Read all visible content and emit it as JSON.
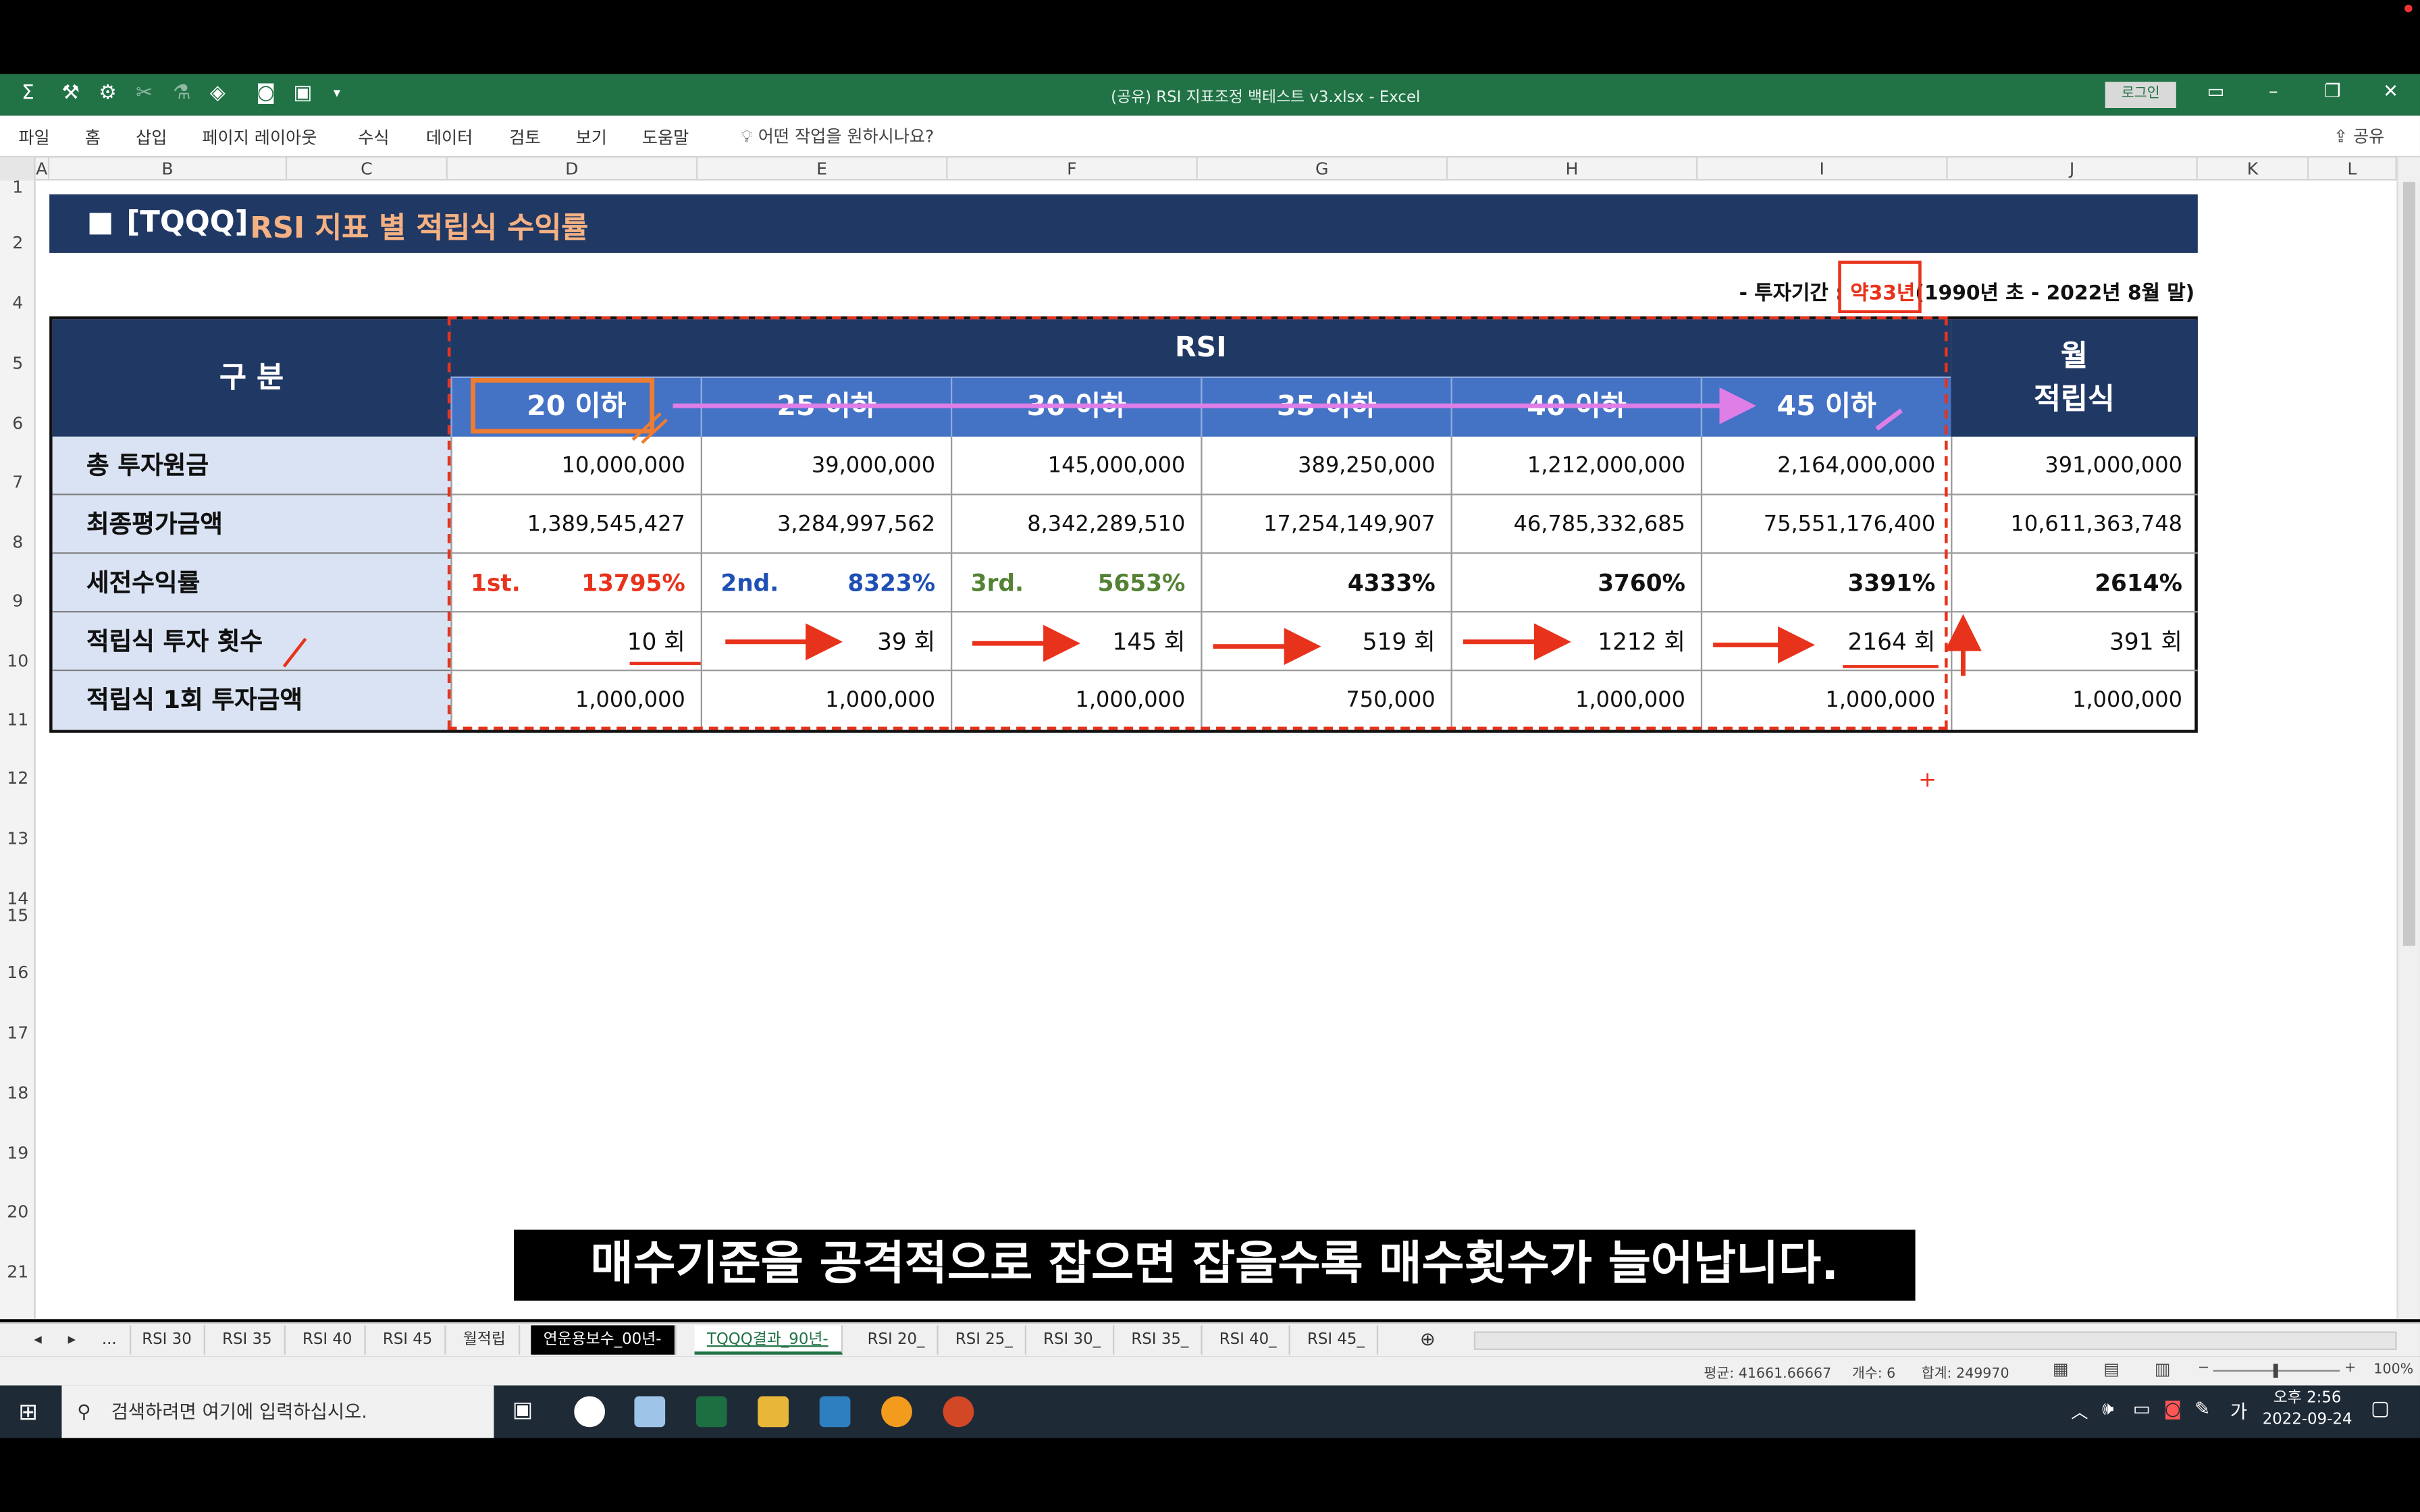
{
  "window": {
    "title": "(공유) RSI 지표조정 백테스트 v3.xlsx  -  Excel",
    "login": "로그인",
    "share": "공유"
  },
  "ribbon": {
    "tabs": [
      "파일",
      "홈",
      "삽입",
      "페이지 레이아웃",
      "수식",
      "데이터",
      "검토",
      "보기",
      "도움말"
    ],
    "tell_me": "어떤 작업을 원하시나요?"
  },
  "columns": [
    "A",
    "B",
    "C",
    "D",
    "E",
    "F",
    "G",
    "H",
    "I",
    "J",
    "K",
    "L"
  ],
  "rows": [
    "1",
    "2",
    "4",
    "5",
    "6",
    "7",
    "8",
    "9",
    "10",
    "11",
    "12",
    "13",
    "14",
    "15",
    "16",
    "17",
    "18",
    "19",
    "20",
    "21"
  ],
  "banner": {
    "code": "[TQQQ]",
    "title": "RSI 지표 별 적립식 수익률"
  },
  "period": {
    "prefix": "- 투자기간 : ",
    "highlight": "약33년",
    "suffix": "(1990년 초 - 2022년 8월 말)"
  },
  "table": {
    "category_header": "구 분",
    "rsi_header": "RSI",
    "monthly_header_1": "월",
    "monthly_header_2": "적립식",
    "rsi_levels": [
      "20 이하",
      "25 이하",
      "30 이하",
      "35 이하",
      "40 이하",
      "45 이하"
    ],
    "row_labels": [
      "총 투자원금",
      "최종평가금액",
      "세전수익률",
      "적립식 투자 횟수",
      "적립식 1회 투자금액"
    ],
    "principal": [
      "10,000,000",
      "39,000,000",
      "145,000,000",
      "389,250,000",
      "1,212,000,000",
      "2,164,000,000",
      "391,000,000"
    ],
    "final_value": [
      "1,389,545,427",
      "3,284,997,562",
      "8,342,289,510",
      "17,254,149,907",
      "46,785,332,685",
      "75,551,176,400",
      "10,611,363,748"
    ],
    "return_rank": [
      "1st.",
      "2nd.",
      "3rd.",
      "",
      "",
      "",
      ""
    ],
    "return_pct": [
      "13795%",
      "8323%",
      "5653%",
      "4333%",
      "3760%",
      "3391%",
      "2614%"
    ],
    "count": [
      "10 회",
      "39 회",
      "145 회",
      "519 회",
      "1212 회",
      "2164 회",
      "391 회"
    ],
    "per_buy": [
      "1,000,000",
      "1,000,000",
      "1,000,000",
      "750,000",
      "1,000,000",
      "1,000,000",
      "1,000,000"
    ]
  },
  "colors": {
    "banner": "#203864",
    "accent_orange": "#f4b183",
    "rank1": "#e8331c",
    "rank2": "#1f4fb5",
    "rank3": "#548235",
    "annotation": "#e8331c",
    "pink": "#e07ee8"
  },
  "caption": "매수기준을 공격적으로 잡으면 잡을수록 매수횟수가 늘어납니다.",
  "sheet_tabs": [
    "RSI 30",
    "RSI 35",
    "RSI 40",
    "RSI 45",
    "월적립",
    "연운용보수_00년-",
    "TQQQ결과_90년-",
    "RSI 20_",
    "RSI 25_",
    "RSI 30_",
    "RSI 35_",
    "RSI 40_",
    "RSI 45_"
  ],
  "status": {
    "average": "평균: 41661.66667",
    "count": "개수: 6",
    "sum": "합계: 249970",
    "zoom": "100%"
  },
  "taskbar": {
    "search_placeholder": "검색하려면 여기에 입력하십시오.",
    "ime": "가",
    "time": "오후 2:56",
    "date": "2022-09-24"
  }
}
